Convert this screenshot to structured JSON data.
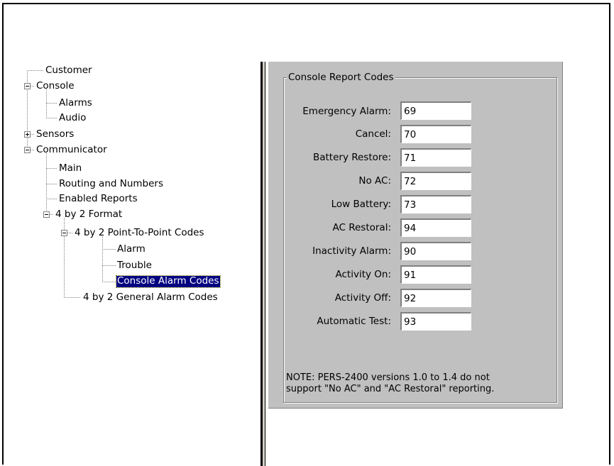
{
  "tree": {
    "items": [
      {
        "label": "Customer"
      },
      {
        "label": "Console"
      },
      {
        "label": "Alarms"
      },
      {
        "label": "Audio"
      },
      {
        "label": "Sensors"
      },
      {
        "label": "Communicator"
      },
      {
        "label": "Main"
      },
      {
        "label": "Routing and Numbers"
      },
      {
        "label": "Enabled Reports"
      },
      {
        "label": "4 by 2 Format"
      },
      {
        "label": "4 by 2 Point-To-Point Codes"
      },
      {
        "label": "Alarm"
      },
      {
        "label": "Trouble"
      },
      {
        "label": "Console Alarm Codes",
        "selected": true
      },
      {
        "label": "4 by 2 General Alarm Codes"
      }
    ],
    "expanders": [
      {
        "state": "expanded"
      },
      {
        "state": "collapsed"
      },
      {
        "state": "expanded"
      },
      {
        "state": "expanded"
      },
      {
        "state": "expanded"
      }
    ]
  },
  "panel": {
    "group_title": "Console Report Codes",
    "fields": [
      {
        "label": "Emergency Alarm:",
        "value": "69"
      },
      {
        "label": "Cancel:",
        "value": "70"
      },
      {
        "label": "Battery Restore:",
        "value": "71"
      },
      {
        "label": "No AC:",
        "value": "72"
      },
      {
        "label": "Low Battery:",
        "value": "73"
      },
      {
        "label": "AC Restoral:",
        "value": "94"
      },
      {
        "label": "Inactivity Alarm:",
        "value": "90"
      },
      {
        "label": "Activity On:",
        "value": "91"
      },
      {
        "label": "Activity Off:",
        "value": "92"
      },
      {
        "label": "Automatic Test:",
        "value": "93"
      }
    ],
    "note_line1": "NOTE: PERS-2400 versions 1.0 to 1.4 do not",
    "note_line2": "support \"No AC\" and \"AC Restoral\" reporting."
  }
}
